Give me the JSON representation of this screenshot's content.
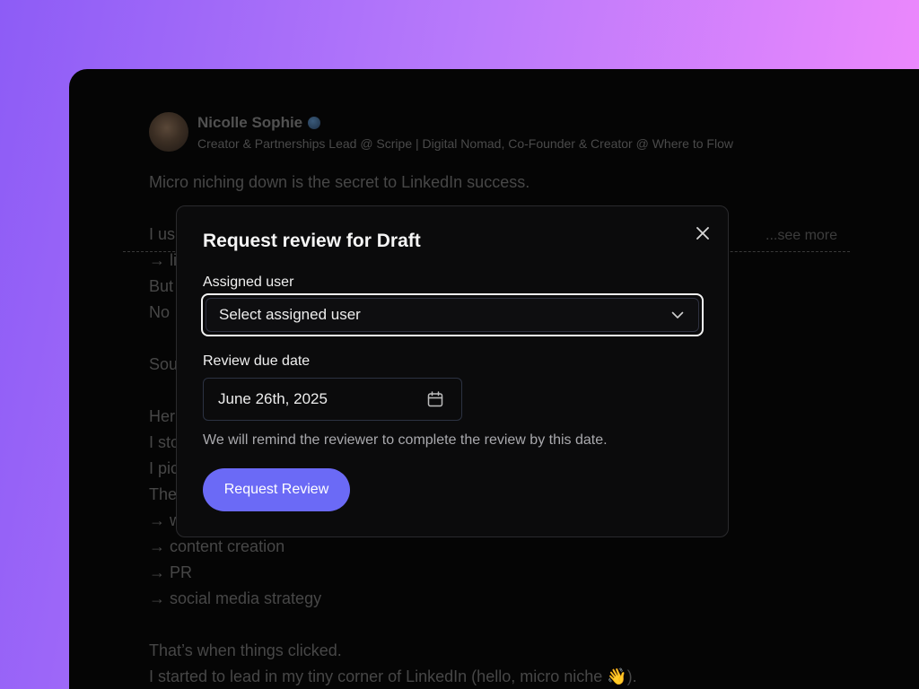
{
  "post": {
    "author_name": "Nicolle Sophie",
    "author_headline": "Creator & Partnerships Lead @ Scripe | Digital Nomad, Co-Founder & Creator @ Where to Flow",
    "see_more": "...see more",
    "lines": [
      "Micro niching down is the secret to LinkedIn success.",
      "",
      "I us",
      "→ li",
      "But",
      "No",
      "",
      "Sou",
      "",
      "Her",
      "I sto",
      "I pic",
      "The",
      "→ w",
      "→ content creation",
      "→ PR",
      "→ social media strategy",
      "",
      "That’s when things clicked.",
      "I started to lead in my tiny corner of LinkedIn (hello, micro niche 👋)."
    ]
  },
  "modal": {
    "title": "Request review for Draft",
    "assigned_user_label": "Assigned user",
    "assigned_user_placeholder": "Select assigned user",
    "due_date_label": "Review due date",
    "due_date_value": "June 26th, 2025",
    "helper_text": "We will remind the reviewer to complete the review by this date.",
    "submit_label": "Request Review"
  },
  "icons": {
    "close": "close-icon",
    "chevron": "chevron-down-icon",
    "calendar": "calendar-icon",
    "globe": "globe-icon"
  },
  "colors": {
    "accent": "#6b6af6",
    "background_gradient_start": "#8d5cf6",
    "background_gradient_end": "#f78bfc"
  }
}
